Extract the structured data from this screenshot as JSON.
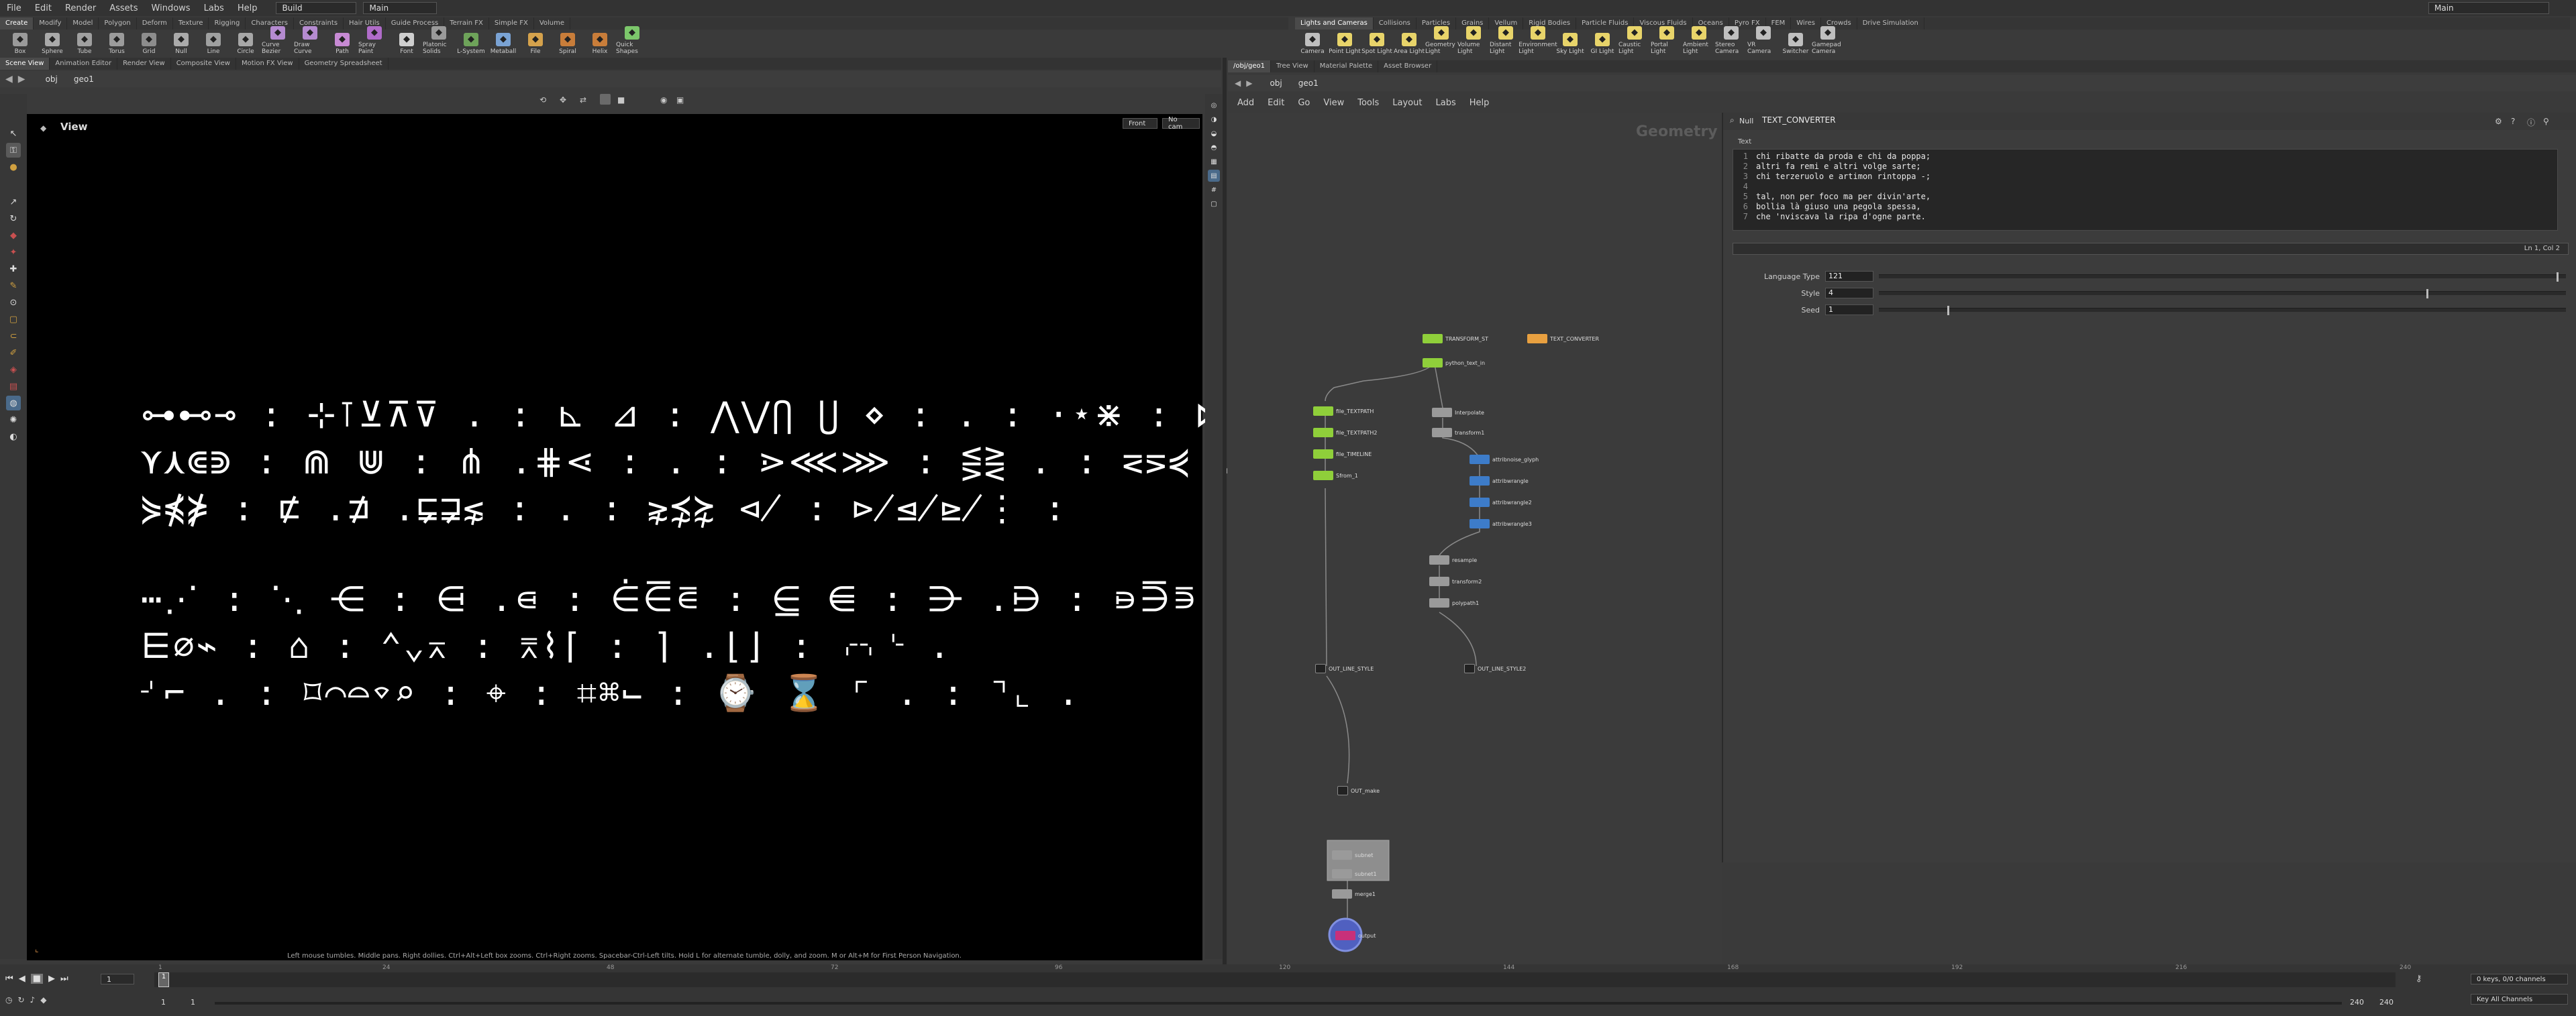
{
  "menubar": {
    "items": [
      "File",
      "Edit",
      "Render",
      "Assets",
      "Windows",
      "Labs",
      "Help"
    ],
    "desktop": "Build",
    "network": "Main",
    "right_user": "Main"
  },
  "shelf_left": {
    "tabs": [
      "Create",
      "Modify",
      "Model",
      "Polygon",
      "Deform",
      "Texture",
      "Rigging",
      "Characters",
      "Constraints",
      "Hair Utils",
      "Guide Process",
      "Terrain FX",
      "Simple FX",
      "Volume"
    ],
    "tools": [
      {
        "label": "Box",
        "icon": "box-icon",
        "color": "#9a9a9a"
      },
      {
        "label": "Sphere",
        "icon": "sphere-icon",
        "color": "#a9a9a9"
      },
      {
        "label": "Tube",
        "icon": "tube-icon",
        "color": "#a0a0a0"
      },
      {
        "label": "Torus",
        "icon": "torus-icon",
        "color": "#9b9b9b"
      },
      {
        "label": "Grid",
        "icon": "grid-icon",
        "color": "#8d8d8d"
      },
      {
        "label": "Null",
        "icon": "null-icon",
        "color": "#aaaaaa"
      },
      {
        "label": "Line",
        "icon": "line-icon",
        "color": "#9fa0a0"
      },
      {
        "label": "Circle",
        "icon": "circle-icon",
        "color": "#a7a7a7"
      },
      {
        "label": "Curve Bezier",
        "icon": "curve-bezier-icon",
        "color": "#b58bd0"
      },
      {
        "label": "Draw Curve",
        "icon": "draw-curve-icon",
        "color": "#b58bd0"
      },
      {
        "label": "Path",
        "icon": "path-icon",
        "color": "#c78ad4"
      },
      {
        "label": "Spray Paint",
        "icon": "spray-paint-icon",
        "color": "#b06cc9"
      },
      {
        "label": "Font",
        "icon": "font-icon",
        "color": "#cfcfcf"
      },
      {
        "label": "Platonic Solids",
        "icon": "platonic-solids-icon",
        "color": "#9a9a9a"
      },
      {
        "label": "L-System",
        "icon": "l-system-icon",
        "color": "#6ea35a"
      },
      {
        "label": "Metaball",
        "icon": "metaball-icon",
        "color": "#7aa3d4"
      },
      {
        "label": "File",
        "icon": "file-icon",
        "color": "#d5a24c"
      },
      {
        "label": "Spiral",
        "icon": "spiral-icon",
        "color": "#c87d3a"
      },
      {
        "label": "Helix",
        "icon": "helix-icon",
        "color": "#c87d3a"
      },
      {
        "label": "Quick Shapes",
        "icon": "quick-shapes-icon",
        "color": "#7cc76b"
      }
    ]
  },
  "shelf_right": {
    "tabs": [
      "Lights and Cameras",
      "Collisions",
      "Particles",
      "Grains",
      "Vellum",
      "Rigid Bodies",
      "Particle Fluids",
      "Viscous Fluids",
      "Oceans",
      "Pyro FX",
      "FEM",
      "Wires",
      "Crowds",
      "Drive Simulation"
    ],
    "tools": [
      {
        "label": "Camera",
        "icon": "camera-icon",
        "color": "#bfbfbf"
      },
      {
        "label": "Point Light",
        "icon": "point-light-icon",
        "color": "#e8d46a"
      },
      {
        "label": "Spot Light",
        "icon": "spot-light-icon",
        "color": "#e8d46a"
      },
      {
        "label": "Area Light",
        "icon": "area-light-icon",
        "color": "#e8d46a"
      },
      {
        "label": "Geometry Light",
        "icon": "geometry-light-icon",
        "color": "#e8d46a"
      },
      {
        "label": "Volume Light",
        "icon": "volume-light-icon",
        "color": "#e8d46a"
      },
      {
        "label": "Distant Light",
        "icon": "distant-light-icon",
        "color": "#e8d46a"
      },
      {
        "label": "Environment Light",
        "icon": "environment-light-icon",
        "color": "#e8d46a"
      },
      {
        "label": "Sky Light",
        "icon": "sky-light-icon",
        "color": "#e8d46a"
      },
      {
        "label": "GI Light",
        "icon": "gi-light-icon",
        "color": "#e8d46a"
      },
      {
        "label": "Caustic Light",
        "icon": "caustic-light-icon",
        "color": "#e8d46a"
      },
      {
        "label": "Portal Light",
        "icon": "portal-light-icon",
        "color": "#e8d46a"
      },
      {
        "label": "Ambient Light",
        "icon": "ambient-light-icon",
        "color": "#e8d46a"
      },
      {
        "label": "Stereo Camera",
        "icon": "stereo-camera-icon",
        "color": "#bfbfbf"
      },
      {
        "label": "VR Camera",
        "icon": "vr-camera-icon",
        "color": "#bfbfbf"
      },
      {
        "label": "Switcher",
        "icon": "switcher-icon",
        "color": "#bfbfbf"
      },
      {
        "label": "Gamepad Camera",
        "icon": "gamepad-camera-icon",
        "color": "#bfbfbf"
      }
    ]
  },
  "viewer": {
    "pane_tabs": [
      "Scene View",
      "Animation Editor",
      "Render View",
      "Composite View",
      "Motion FX View",
      "Geometry Spreadsheet"
    ],
    "path": [
      "obj",
      "geo1"
    ],
    "title": "View",
    "camera_menu": "Front",
    "cam_menu": "No cam",
    "glyph_lines": [
      "⊶⊷⊸ : ⊹⊺⊻⊼⊽ . : ⊾ ⊿ : ⋀⋁⋂ ⋃ ⋄ : . : ⋅⋆⋇ : ⋈ ⋉ : ⋊⋋⋌⋍",
      "⋎⋏⋐⋑ : ⋒ ⋓ : ⋔ .⋕⋖ : . : ⋗⋘⋙ : ⋚⋛ . : ⋜⋝⋞ .",
      "⋟⋠⋡ : ⋢ .⋣ .⋤⋥⋦ : . : ⋧⋨⋩ ⋪ : ⋫⋬⋭⋮ :",
      "",
      "⋯⋰ : ⋱ ⋲ : ⋳ .⋴ : ⋵⋶⋷ : ⋸ ⋹ : ⋺ .⋻ : ⋼⋽⋾ .",
      "⋿⌀⌁ : ⌂ : ⌃⌄⌅ : ⌆⌇⌈ : ⌉ .⌊⌋ : ⌌⌍⌎ .",
      "⌏⌐ . : ⌑⌒⌓⌔⌕ : ⌖ : ⌗⌘⌙ : ⌚ ⌛ ⌜ . : ⌝⌞ ."
    ],
    "hint": "Left mouse tumbles. Middle pans. Right dollies. Ctrl+Alt+Left box zooms. Ctrl+Right zooms. Spacebar-Ctrl-Left tilts. Hold L for alternate tumble, dolly, and zoom. M or Alt+M for First Person Navigation."
  },
  "network": {
    "pane_tabs": [
      "/obj/geo1",
      "Tree View",
      "Material Palette",
      "Asset Browser"
    ],
    "path": [
      "obj",
      "geo1"
    ],
    "menu": [
      "Add",
      "Edit",
      "Go",
      "View",
      "Tools",
      "Layout",
      "Labs",
      "Help"
    ],
    "context_label": "Geometry",
    "nodes": [
      {
        "label": "TRANSFORM_ST",
        "color": "#8fcf3a"
      },
      {
        "label": "TEXT_CONVERTER",
        "color": "#e8a040"
      },
      {
        "label": "python_text_in",
        "color": "#8fcf3a"
      },
      {
        "label": "file_TEXTPATH",
        "color": "#8fcf3a"
      },
      {
        "label": "file_TEXTPATH2",
        "color": "#8fcf3a"
      },
      {
        "label": "file_TIMELINE",
        "color": "#8fcf3a"
      },
      {
        "label": "Sfrom_1",
        "color": "#8fcf3a"
      },
      {
        "label": "Interpolate",
        "color": "#9a9a9a"
      },
      {
        "label": "transform1",
        "color": "#9a9a9a"
      },
      {
        "label": "attribnoise_glyph",
        "color": "#3d7cc9"
      },
      {
        "label": "attribwrangle",
        "color": "#3d7cc9"
      },
      {
        "label": "attribwrangle2",
        "color": "#3d7cc9"
      },
      {
        "label": "attribwrangle3",
        "color": "#3d7cc9"
      },
      {
        "label": "resample",
        "color": "#9a9a9a"
      },
      {
        "label": "transform2",
        "color": "#9a9a9a"
      },
      {
        "label": "polypath1",
        "color": "#9a9a9a"
      },
      {
        "label": "OUT_LINE_STYLE",
        "color": "#222222"
      },
      {
        "label": "OUT_LINE_STYLE2",
        "color": "#222222"
      },
      {
        "label": "subnet",
        "color": "#9a9a9a"
      },
      {
        "label": "subnet1",
        "color": "#9a9a9a"
      },
      {
        "label": "merge1",
        "color": "#9a9a9a"
      },
      {
        "label": "OUT_make",
        "color": "#222222"
      },
      {
        "label": "output",
        "color": "#c8307a"
      }
    ]
  },
  "params": {
    "node_type": "Null",
    "node_name": "TEXT_CONVERTER",
    "text_label": "Text",
    "text_lines": [
      "chi ribatte da proda e chi da poppa;",
      "altri fa remi e altri volge sarte;",
      "chi terzeruolo e artimon rintoppa -;",
      "",
      "tal, non per foco ma per divin'arte,",
      "bollia là giuso una pegola spessa,",
      "che 'nviscava la ripa d'ogne parte."
    ],
    "line_numbers": [
      "1",
      "2",
      "3",
      "4",
      "5",
      "6",
      "7"
    ],
    "cursor_pos": "Ln 1, Col 2",
    "fields": [
      {
        "label": "Language Type",
        "value": "121",
        "fraction": 0.99
      },
      {
        "label": "Style",
        "value": "4",
        "fraction": 0.8
      },
      {
        "label": "Seed",
        "value": "1",
        "fraction": 0.1
      }
    ]
  },
  "timeline": {
    "frame_current": "1",
    "frame_start": "1",
    "frame_start2": "1",
    "frame_end": "240",
    "frame_end2": "240",
    "ticks": [
      "1",
      "24",
      "48",
      "72",
      "96",
      "120",
      "144",
      "168",
      "192",
      "216",
      "240"
    ],
    "keys_status": "0 keys, 0/0 channels",
    "key_all": "Key All Channels"
  }
}
